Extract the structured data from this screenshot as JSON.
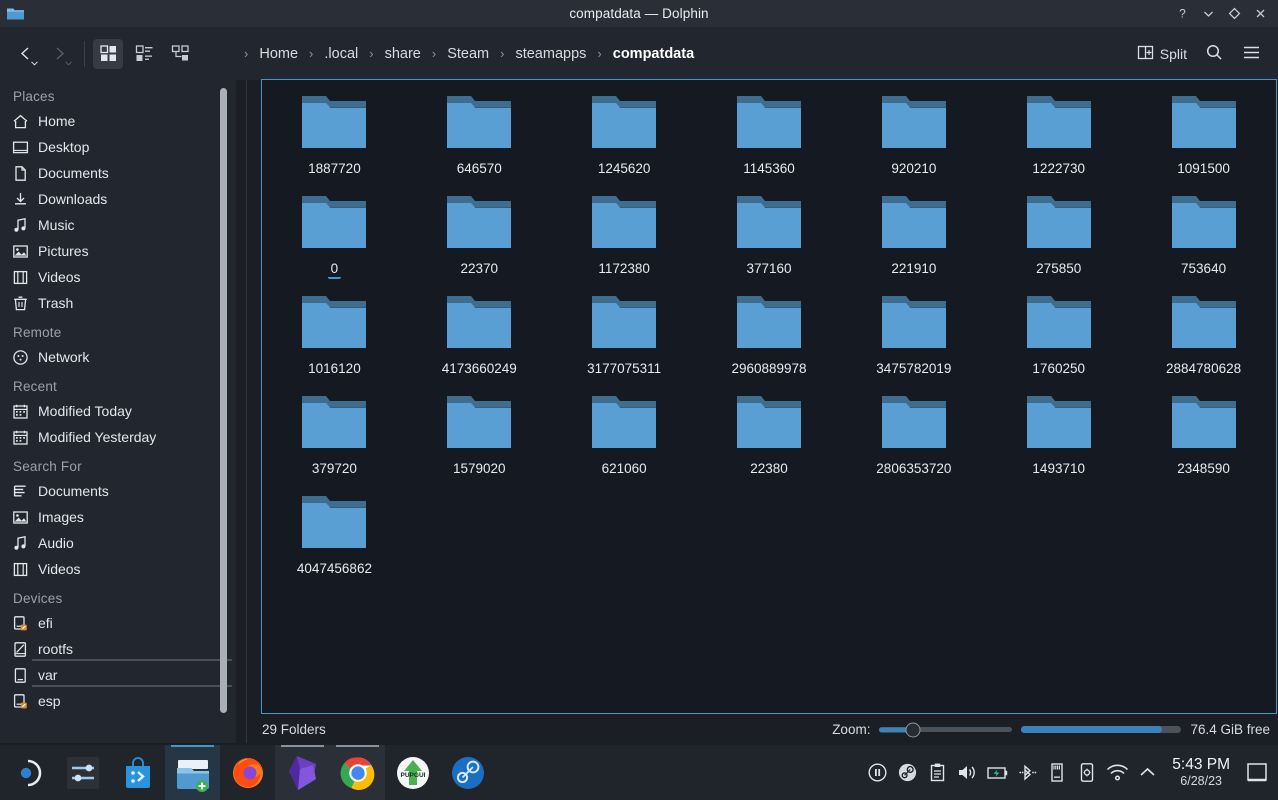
{
  "window": {
    "title": "compatdata — Dolphin",
    "icon": "folder-icon",
    "buttons": [
      {
        "name": "help-button",
        "glyph": "?"
      },
      {
        "name": "minimize-button",
        "glyph": "⌄"
      },
      {
        "name": "maximize-button",
        "glyph": "◇"
      },
      {
        "name": "close-button",
        "glyph": "✕"
      }
    ]
  },
  "toolbar": {
    "back_label": "Back",
    "forward_label": "Forward",
    "view_modes": [
      {
        "name": "view-mode-icons",
        "label": "Icons",
        "active": true
      },
      {
        "name": "view-mode-compact",
        "label": "Compact",
        "active": false
      },
      {
        "name": "view-mode-details",
        "label": "Details",
        "active": false
      }
    ],
    "split_label": "Split",
    "search_label": "Search",
    "menu_label": "Menu"
  },
  "breadcrumb": {
    "items": [
      "Home",
      ".local",
      "share",
      "Steam",
      "steamapps",
      "compatdata"
    ],
    "current": "compatdata",
    "separator": "›"
  },
  "sidebar": {
    "groups": [
      {
        "title": "Places",
        "items": [
          {
            "label": "Home",
            "icon": "home-icon"
          },
          {
            "label": "Desktop",
            "icon": "desktop-icon"
          },
          {
            "label": "Documents",
            "icon": "document-icon"
          },
          {
            "label": "Downloads",
            "icon": "download-icon"
          },
          {
            "label": "Music",
            "icon": "music-icon"
          },
          {
            "label": "Pictures",
            "icon": "image-icon"
          },
          {
            "label": "Videos",
            "icon": "video-icon"
          },
          {
            "label": "Trash",
            "icon": "trash-icon"
          }
        ]
      },
      {
        "title": "Remote",
        "items": [
          {
            "label": "Network",
            "icon": "network-icon"
          }
        ]
      },
      {
        "title": "Recent",
        "items": [
          {
            "label": "Modified Today",
            "icon": "calendar-icon"
          },
          {
            "label": "Modified Yesterday",
            "icon": "calendar-icon"
          }
        ]
      },
      {
        "title": "Search For",
        "items": [
          {
            "label": "Documents",
            "icon": "document-search-icon"
          },
          {
            "label": "Images",
            "icon": "image-icon"
          },
          {
            "label": "Audio",
            "icon": "music-icon"
          },
          {
            "label": "Videos",
            "icon": "video-icon"
          }
        ]
      },
      {
        "title": "Devices",
        "items": [
          {
            "label": "efi",
            "icon": "drive-removable-icon",
            "capacity": null
          },
          {
            "label": "rootfs",
            "icon": "drive-harddisk-icon",
            "capacity": 100
          },
          {
            "label": "var",
            "icon": "drive-icon",
            "capacity": 100
          },
          {
            "label": "esp",
            "icon": "drive-removable-icon",
            "capacity": null
          }
        ]
      }
    ]
  },
  "content": {
    "folders": [
      "1887720",
      "646570",
      "1245620",
      "1145360",
      "920210",
      "1222730",
      "1091500",
      "0",
      "22370",
      "1172380",
      "377160",
      "221910",
      "275850",
      "753640",
      "1016120",
      "4173660249",
      "3177075311",
      "2960889978",
      "3475782019",
      "1760250",
      "2884780628",
      "379720",
      "1579020",
      "621060",
      "22380",
      "2806353720",
      "1493710",
      "2348590",
      "4047456862"
    ],
    "focused_index": 7,
    "columns": 7
  },
  "statusbar": {
    "count_text": "29 Folders",
    "zoom_label": "Zoom:",
    "zoom_percent": 25,
    "space_text": "76.4 GiB free",
    "space_percent": 88
  },
  "taskbar": {
    "tasks": [
      {
        "name": "task-application-launcher",
        "label": "Application Launcher",
        "state": "idle"
      },
      {
        "name": "task-system-settings",
        "label": "System Settings",
        "state": "idle"
      },
      {
        "name": "task-discover",
        "label": "Discover",
        "state": "idle"
      },
      {
        "name": "task-dolphin",
        "label": "Dolphin",
        "state": "active"
      },
      {
        "name": "task-firefox",
        "label": "Firefox",
        "state": "idle"
      },
      {
        "name": "task-obsidian",
        "label": "Obsidian",
        "state": "running"
      },
      {
        "name": "task-chrome",
        "label": "Google Chrome",
        "state": "running"
      },
      {
        "name": "task-protonup",
        "label": "ProtonUp-Qt",
        "state": "idle"
      },
      {
        "name": "task-steam",
        "label": "Steam",
        "state": "idle"
      }
    ],
    "tray": [
      {
        "name": "media-player-icon",
        "label": "Media Player"
      },
      {
        "name": "steam-tray-icon",
        "label": "Steam"
      },
      {
        "name": "clipboard-icon",
        "label": "Clipboard"
      },
      {
        "name": "volume-icon",
        "label": "Volume"
      },
      {
        "name": "battery-icon",
        "label": "Battery"
      },
      {
        "name": "bluetooth-icon",
        "label": "Bluetooth"
      },
      {
        "name": "usb-device-icon",
        "label": "Disks & Devices"
      },
      {
        "name": "kdeconnect-icon",
        "label": "KDE Connect"
      },
      {
        "name": "wifi-icon",
        "label": "Networks"
      },
      {
        "name": "show-hidden-icons-icon",
        "label": "Show hidden icons"
      }
    ],
    "clock": {
      "time": "5:43 PM",
      "date": "6/28/23"
    },
    "show_desktop_label": "Show Desktop"
  },
  "colors": {
    "accent": "#3d9ac9",
    "folder_body": "#5a9fd4",
    "folder_tab": "#3d6e8f",
    "window_bg": "#22262e",
    "view_bg": "#151921"
  }
}
